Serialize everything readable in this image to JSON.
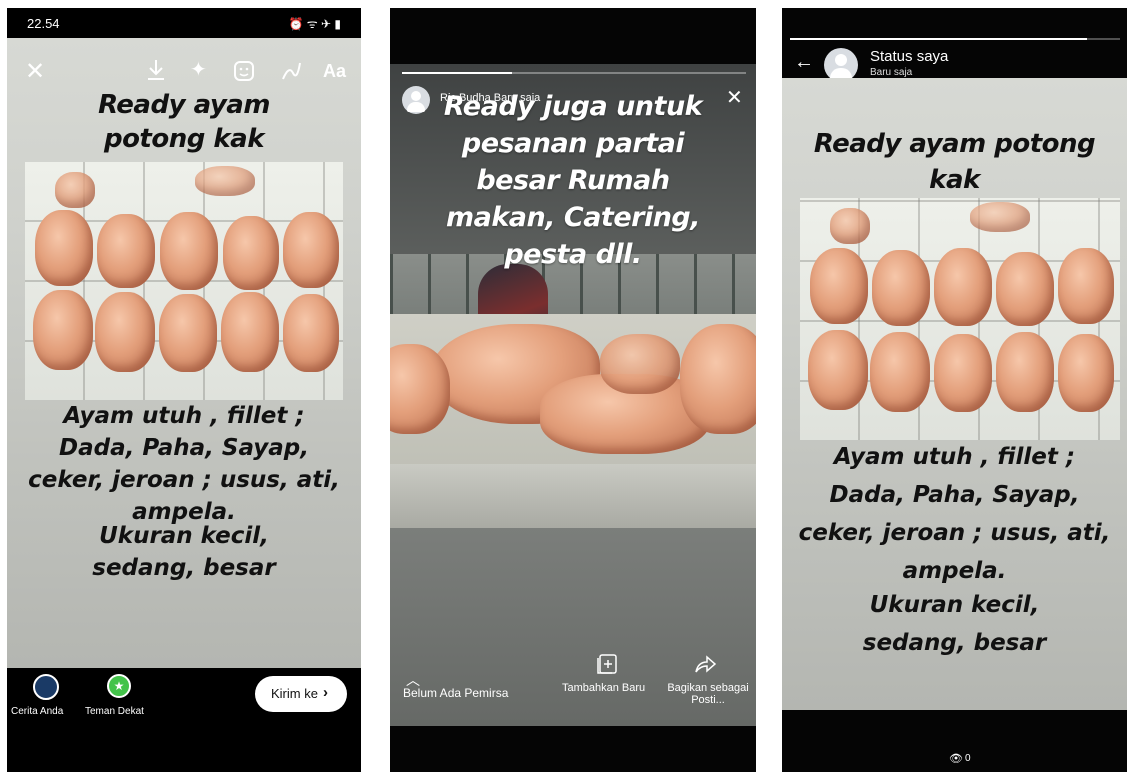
{
  "phone1": {
    "status_time": "22.54",
    "toolbar": {
      "text_tool": "Aa"
    },
    "story_headline": "Ready ayam potong kak",
    "story_body_1": "Ayam utuh , fillet ; Dada, Paha, Sayap, ceker, jeroan ; usus, ati, ampela.",
    "story_body_2": "Ukuran kecil, sedang, besar",
    "audience": {
      "your_story": "Cerita Anda",
      "close_friends": "Teman Dekat"
    },
    "send_button": "Kirim ke"
  },
  "phone2": {
    "author": "Ric Budha Baru saja",
    "story_text": "Ready juga untuk pesanan partai besar Rumah makan, Catering, pesta dll.",
    "viewers_label": "Belum Ada Pemirsa",
    "add_new_label": "Tambahkan Baru",
    "share_label": "Bagikan sebagai Posti..."
  },
  "phone3": {
    "title": "Status saya",
    "subtitle": "Baru saja",
    "story_headline": "Ready ayam potong kak",
    "story_body_1": "Ayam utuh , fillet ; Dada, Paha, Sayap, ceker, jeroan ; usus, ati, ampela.",
    "story_body_2": "Ukuran kecil, sedang, besar",
    "view_count": "0"
  },
  "colors": {
    "accent_green": "#43c34a",
    "bar_black": "#000000",
    "story_grey": "#cfd1cc"
  },
  "icons": [
    "close-icon",
    "download-icon",
    "sparkle-icon",
    "sticker-icon",
    "draw-icon",
    "chevron-right-icon",
    "add-icon",
    "share-icon",
    "back-arrow-icon",
    "eye-icon",
    "avatar-icon"
  ]
}
